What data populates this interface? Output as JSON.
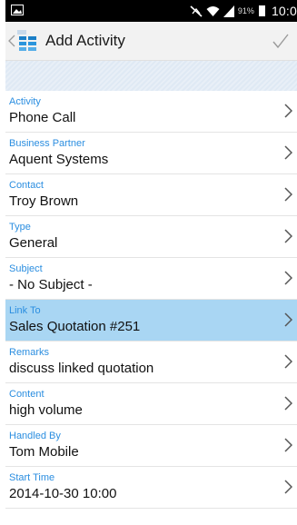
{
  "status_bar": {
    "battery_percent": "91%",
    "time": "10:0"
  },
  "header": {
    "title": "Add Activity"
  },
  "fields": [
    {
      "label": "Activity",
      "value": "Phone Call"
    },
    {
      "label": "Business Partner",
      "value": "Aquent Systems"
    },
    {
      "label": "Contact",
      "value": "Troy Brown"
    },
    {
      "label": "Type",
      "value": "General"
    },
    {
      "label": "Subject",
      "value": "- No Subject -"
    },
    {
      "label": "Link To",
      "value": "Sales Quotation #251"
    },
    {
      "label": "Remarks",
      "value": "discuss linked quotation"
    },
    {
      "label": "Content",
      "value": "high volume"
    },
    {
      "label": "Handled By",
      "value": "Tom Mobile"
    },
    {
      "label": "Start Time",
      "value": "2014-10-30 10:00"
    }
  ],
  "selected_index": 5,
  "colors": {
    "label_blue": "#2b8ee0",
    "selected_row": "#a9d6f3",
    "status_bar": "#000000"
  },
  "icons": [
    "gallery-icon",
    "mute-icon",
    "wifi-icon",
    "signal-icon",
    "battery-icon",
    "back-chevron-icon",
    "app-icon",
    "check-icon",
    "chevron-right-icon"
  ]
}
